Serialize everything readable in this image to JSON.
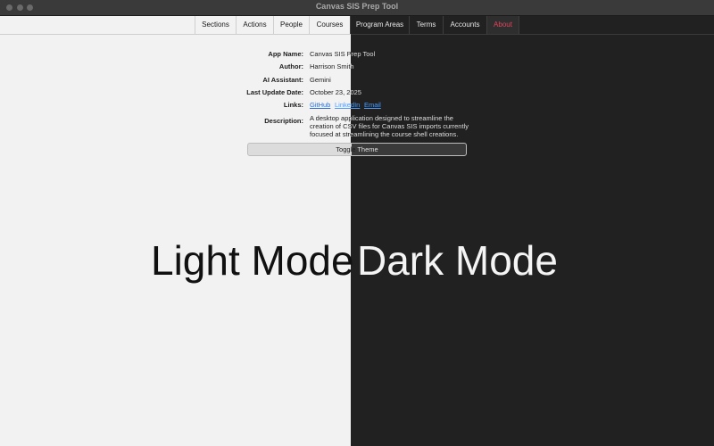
{
  "window": {
    "title": "Canvas SIS Prep Tool"
  },
  "tabs": [
    {
      "label": "Sections",
      "selected": false
    },
    {
      "label": "Actions",
      "selected": false
    },
    {
      "label": "People",
      "selected": false
    },
    {
      "label": "Courses",
      "selected": false
    },
    {
      "label": "Program Areas",
      "selected": false
    },
    {
      "label": "Terms",
      "selected": false
    },
    {
      "label": "Accounts",
      "selected": false
    },
    {
      "label": "About",
      "selected": true
    }
  ],
  "about": {
    "app_name_label": "App Name:",
    "app_name": "Canvas SIS Prep Tool",
    "author_label": "Author:",
    "author": "Harrison Smith",
    "ai_label": "AI Assistant:",
    "ai": "Gemini",
    "update_label": "Last Update Date:",
    "update": "October 23, 2025",
    "links_label": "Links:",
    "links": [
      "GitHub",
      "LinkedIn",
      "Email"
    ],
    "description_label": "Description:",
    "description": "A desktop application designed to streamline the creation of CSV files for Canvas SIS imports currently focused at streamlining the course shell creations."
  },
  "toggle_theme_label": "Toggle Theme",
  "captions": {
    "light": "Light Mode",
    "dark": "Dark Mode"
  },
  "colors": {
    "accent_selected_tab": "#e0455c",
    "link_light": "#2a6fd6",
    "link_dark": "#4a9cff",
    "light_bg": "#f2f2f2",
    "dark_bg": "#212121"
  }
}
